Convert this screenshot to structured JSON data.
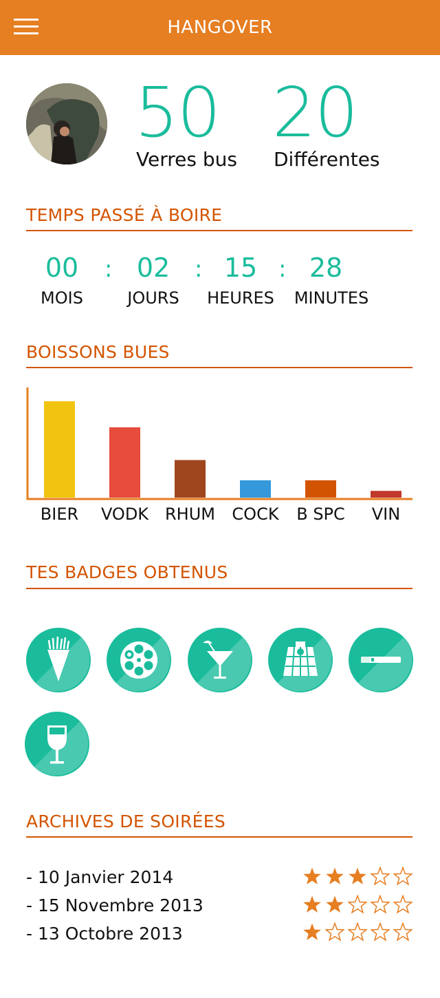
{
  "header": {
    "title": "HANGOVER",
    "menu_icon": "hamburger-menu-icon"
  },
  "profile": {
    "avatar": "profile-photo"
  },
  "stats": [
    {
      "value": "50",
      "label": "Verres bus"
    },
    {
      "value": "20",
      "label": "Différentes"
    }
  ],
  "time": {
    "title": "TEMPS PASSÉ À BOIRE",
    "separator": ":",
    "units": [
      {
        "value": "00",
        "label": "MOIS"
      },
      {
        "value": "02",
        "label": "JOURS"
      },
      {
        "value": "15",
        "label": "HEURES"
      },
      {
        "value": "28",
        "label": "MINUTES"
      }
    ]
  },
  "drinks": {
    "title": "BOISSONS BUES"
  },
  "chart_data": {
    "type": "bar",
    "title": "",
    "xlabel": "",
    "ylabel": "",
    "categories": [
      "BIER",
      "VODK",
      "RHUM",
      "COCK",
      "B SPC",
      "VIN"
    ],
    "values": [
      100,
      73,
      39,
      18,
      18,
      7
    ],
    "ylim": [
      0,
      100
    ],
    "colors": [
      "#f1c40f",
      "#e74c3c",
      "#a0461f",
      "#3498db",
      "#d35400",
      "#c0392b"
    ],
    "axis_color": "#e67e22",
    "grid": false
  },
  "badges": {
    "title": "TES BADGES OBTENUS",
    "color": "#1abc9c",
    "items": [
      {
        "icon": "fries-cone-icon"
      },
      {
        "icon": "revolver-cylinder-icon"
      },
      {
        "icon": "cocktail-glass-icon"
      },
      {
        "icon": "beer-pong-table-icon"
      },
      {
        "icon": "cigarette-icon"
      },
      {
        "icon": "wine-glass-icon"
      }
    ]
  },
  "archives": {
    "title": "ARCHIVES DE SOIRÉES",
    "star_color": "#e67e22",
    "max_rating": 5,
    "items": [
      {
        "date": "- 10 Janvier 2014",
        "rating": 3
      },
      {
        "date": "- 15 Novembre 2013",
        "rating": 2
      },
      {
        "date": "- 13 Octobre 2013",
        "rating": 1
      }
    ]
  }
}
